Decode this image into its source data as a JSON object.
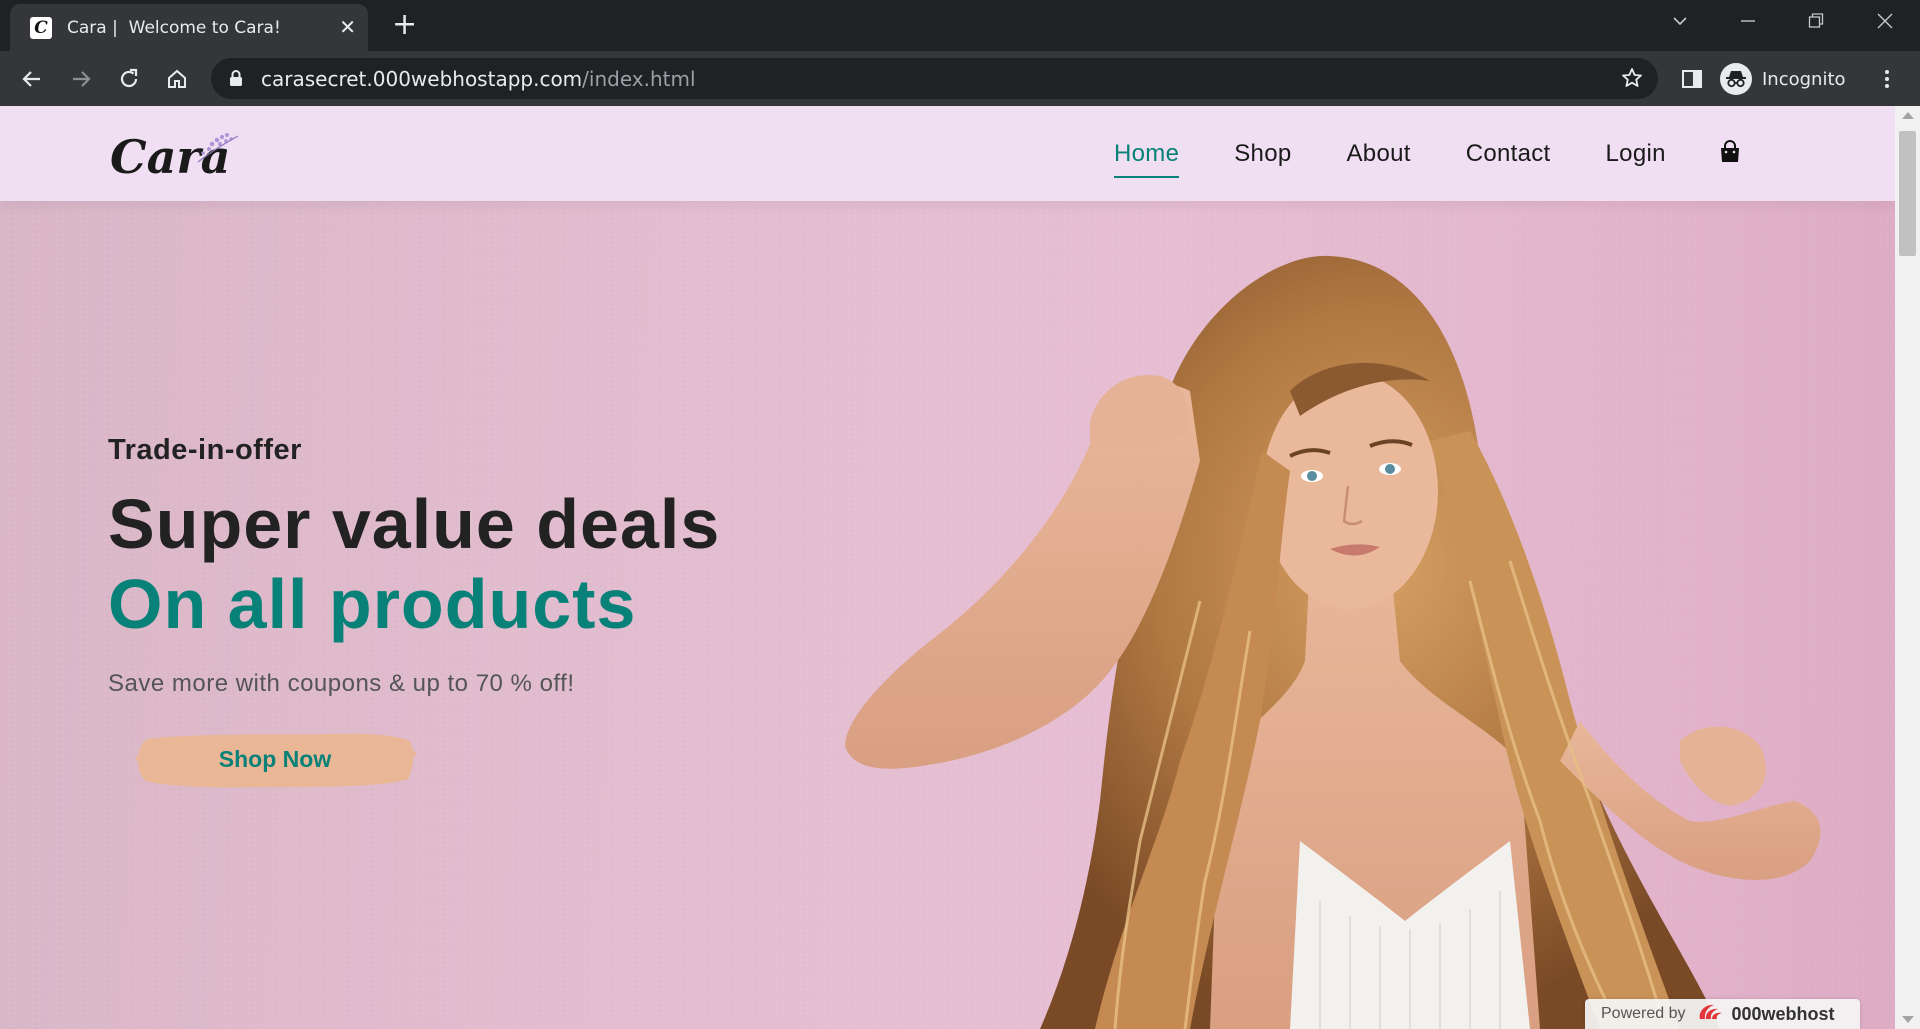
{
  "browser": {
    "tab": {
      "title": "Cara |  Welcome to Cara!",
      "favicon_letter": "C"
    },
    "url": {
      "host": "carasecret.000webhostapp.com",
      "path": "/index.html"
    },
    "profile_label": "Incognito",
    "icons": [
      "back-icon",
      "forward-icon",
      "reload-icon",
      "home-icon",
      "lock-icon",
      "star-icon",
      "sidepanel-icon",
      "incognito-icon",
      "kebab-menu-icon",
      "tab-search-icon",
      "minimize-icon",
      "restore-icon",
      "close-icon"
    ]
  },
  "site": {
    "logo_text": "Cara",
    "nav": [
      {
        "label": "Home",
        "active": true
      },
      {
        "label": "Shop",
        "active": false
      },
      {
        "label": "About",
        "active": false
      },
      {
        "label": "Contact",
        "active": false
      },
      {
        "label": "Login",
        "active": false
      }
    ],
    "cart_icon": "shopping-bag-icon",
    "accent": "#088178",
    "header_bg": "#f0dff2"
  },
  "hero": {
    "kicker": "Trade-in-offer",
    "title": "Super value deals",
    "subtitle": "On all products",
    "text": "Save more with coupons & up to 70 % off!",
    "button": "Shop Now",
    "button_bg": "#eab796"
  },
  "badge": {
    "label": "Powered by",
    "brand": "000webhost"
  }
}
